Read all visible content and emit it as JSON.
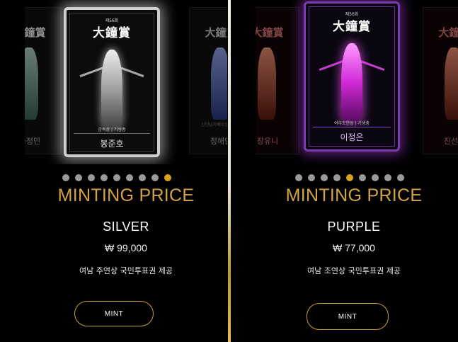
{
  "colors": {
    "accent_gold": "#d3a345",
    "dot_inactive": "#9a9a9a",
    "dot_active": "#d9a21d",
    "silver_glow": "#cfcfcf",
    "purple_glow": "#a83cdc"
  },
  "left": {
    "card": {
      "top_text": "제56회",
      "title": "大鐘賞",
      "caption": "감독상 | 기생충",
      "name": "봉준호"
    },
    "side_cards": {
      "left_name": "승정민",
      "right_name": "정해인",
      "right_caption": "신인남자배우상 | 인질"
    },
    "dots_active_index": 8,
    "price_heading": "MINTING PRICE",
    "tier": "SILVER",
    "price": "₩ 99,000",
    "benefit": "여남 주연상 국민투표권 제공",
    "mint_label": "MINT"
  },
  "right": {
    "card": {
      "top_text": "제56회",
      "title": "大鐘賞",
      "caption": "여우조연상 | 기생충",
      "name": "이정은"
    },
    "side_cards": {
      "left_name": "장유니",
      "right_name": "진선규"
    },
    "dots_active_index": 4,
    "price_heading": "MINTING PRICE",
    "tier": "PURPLE",
    "price": "₩ 77,000",
    "benefit": "여남 조연상 국민투표권 제공",
    "mint_label": "MINT"
  }
}
